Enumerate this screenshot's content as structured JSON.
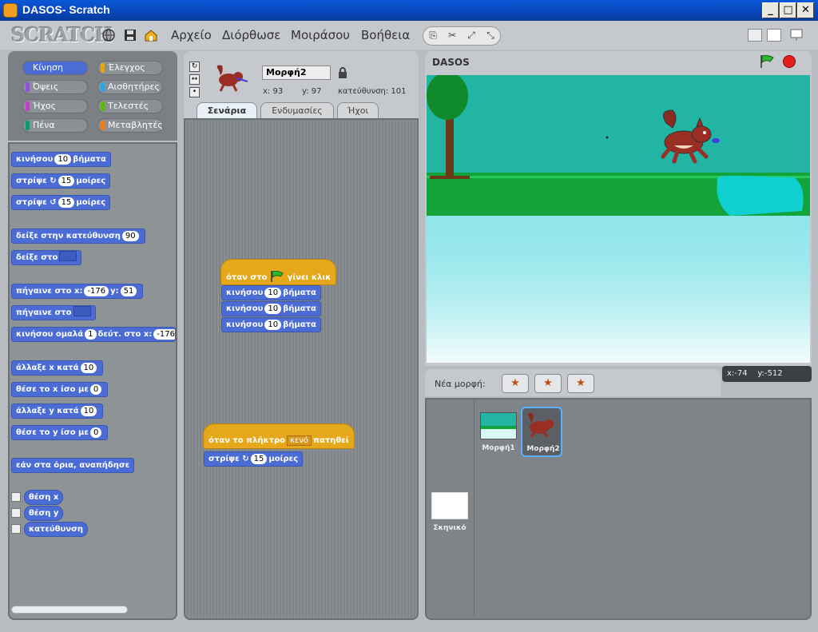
{
  "window": {
    "title": "DASOS- Scratch",
    "min": "_",
    "max": "□",
    "close": "✕"
  },
  "menubar": {
    "logo": "SCRATCH",
    "items": [
      "Αρχείο",
      "Διόρθωσε",
      "Μοιράσου",
      "Βοήθεια"
    ]
  },
  "categories": [
    {
      "label": "Κίνηση",
      "color": "#4a6cd4"
    },
    {
      "label": "Έλεγχος",
      "color": "#e1a91a"
    },
    {
      "label": "Όψεις",
      "color": "#8a55d7"
    },
    {
      "label": "Αισθητήρες",
      "color": "#2ca5e2"
    },
    {
      "label": "Ήχος",
      "color": "#bb42c3"
    },
    {
      "label": "Τελεστές",
      "color": "#5cb712"
    },
    {
      "label": "Πένα",
      "color": "#0e9a6c"
    },
    {
      "label": "Μεταβλητές",
      "color": "#ee7d16"
    }
  ],
  "palette": {
    "move": {
      "text1": "κινήσου",
      "val": "10",
      "text2": "βήματα"
    },
    "turn_cw": {
      "text1": "στρίψε",
      "val": "15",
      "text2": "μοίρες"
    },
    "turn_ccw": {
      "text1": "στρίψε",
      "val": "15",
      "text2": "μοίρες"
    },
    "point_dir": {
      "text1": "δείξε στην κατεύθυνση",
      "val": "90"
    },
    "point_to": {
      "text1": "δείξε στο"
    },
    "goto_xy": {
      "text1": "πήγαινε στο x:",
      "x": "-176",
      "text2": "y:",
      "y": "51"
    },
    "goto": {
      "text1": "πήγαινε στο"
    },
    "glide": {
      "text1": "κινήσου ομαλά",
      "val": "1",
      "text2": "δεύτ. στο x:",
      "x": "-176"
    },
    "change_x": {
      "text1": "άλλαξε x κατά",
      "val": "10"
    },
    "set_x": {
      "text1": "θέσε το x ίσο με",
      "val": "0"
    },
    "change_y": {
      "text1": "άλλαξε y κατά",
      "val": "10"
    },
    "set_y": {
      "text1": "θέσε το y ίσο με",
      "val": "0"
    },
    "bounce": {
      "text1": "εάν στα όρια, αναπήδησε"
    },
    "reporters": [
      "θέση x",
      "θέση y",
      "κατεύθυνση"
    ]
  },
  "sprite": {
    "name": "Μορφή2",
    "x_label": "x:",
    "x": "93",
    "y_label": "y:",
    "y": "97",
    "dir_label": "κατεύθυνση:",
    "dir": "101"
  },
  "tabs": [
    "Σενάρια",
    "Ενδυμασίες",
    "Ήχοι"
  ],
  "scripts": {
    "hat1": {
      "text1": "όταν στο",
      "text2": "γίνει κλικ"
    },
    "hat1_blocks": [
      {
        "text1": "κινήσου",
        "val": "10",
        "text2": "βήματα"
      },
      {
        "text1": "κινήσου",
        "val": "10",
        "text2": "βήματα"
      },
      {
        "text1": "κινήσου",
        "val": "10",
        "text2": "βήματα"
      }
    ],
    "hat2": {
      "text1": "όταν το πλήκτρο",
      "key": "κενό",
      "text2": "πατηθεί"
    },
    "hat2_block": {
      "text1": "στρίψε",
      "val": "15",
      "text2": "μοίρες"
    }
  },
  "stage": {
    "title": "DASOS"
  },
  "sprites_bar": {
    "label": "Νέα μορφή:"
  },
  "mouse": {
    "x_label": "x:",
    "x": "-74",
    "y_label": "y:",
    "y": "-512"
  },
  "sprite_list": {
    "stage_label": "Σκηνικό",
    "items": [
      "Μορφή1",
      "Μορφή2"
    ]
  }
}
